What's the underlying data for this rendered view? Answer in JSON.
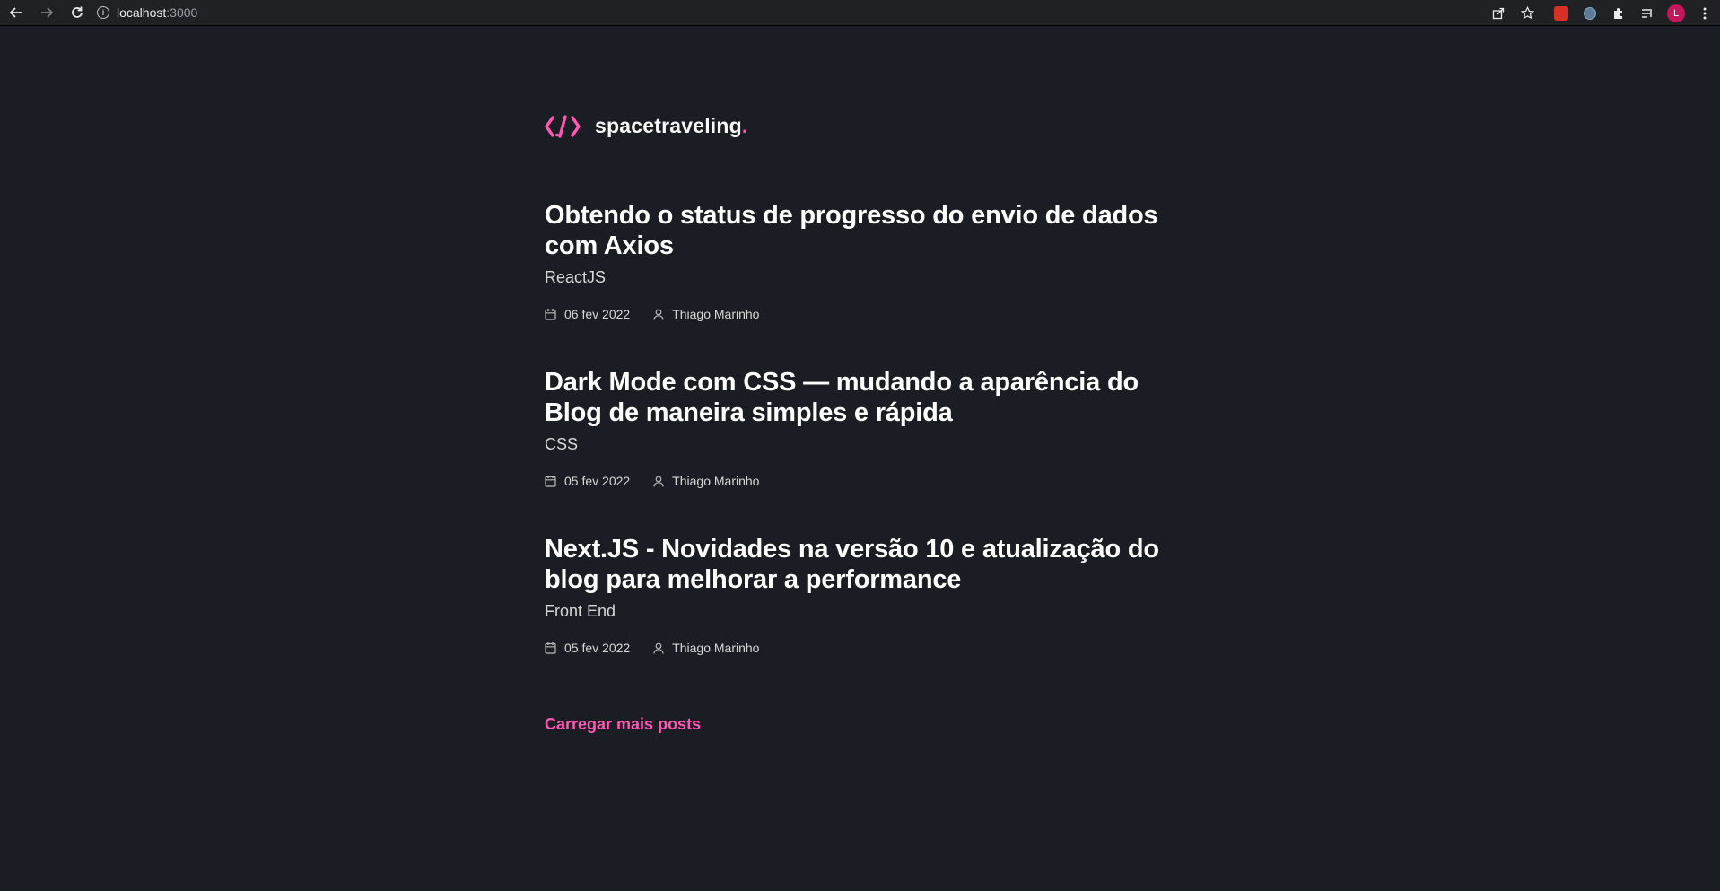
{
  "browser": {
    "url_host": "localhost",
    "url_port": ":3000",
    "avatar_letter": "L"
  },
  "site": {
    "logo_text": "spacetraveling",
    "logo_dot": "."
  },
  "posts": [
    {
      "title": "Obtendo o status de progresso do envio de dados com Axios",
      "subtitle": "ReactJS",
      "date": "06 fev 2022",
      "author": "Thiago Marinho"
    },
    {
      "title": "Dark Mode com CSS — mudando a aparência do Blog de maneira simples e rápida",
      "subtitle": "CSS",
      "date": "05 fev 2022",
      "author": "Thiago Marinho"
    },
    {
      "title": "Next.JS - Novidades na versão 10 e atualização do blog para melhorar a performance",
      "subtitle": "Front End",
      "date": "05 fev 2022",
      "author": "Thiago Marinho"
    }
  ],
  "load_more_label": "Carregar mais posts",
  "colors": {
    "background": "#1a1d23",
    "accent": "#ff57b2",
    "heading": "#ffffff",
    "text": "#d7d7d7"
  }
}
